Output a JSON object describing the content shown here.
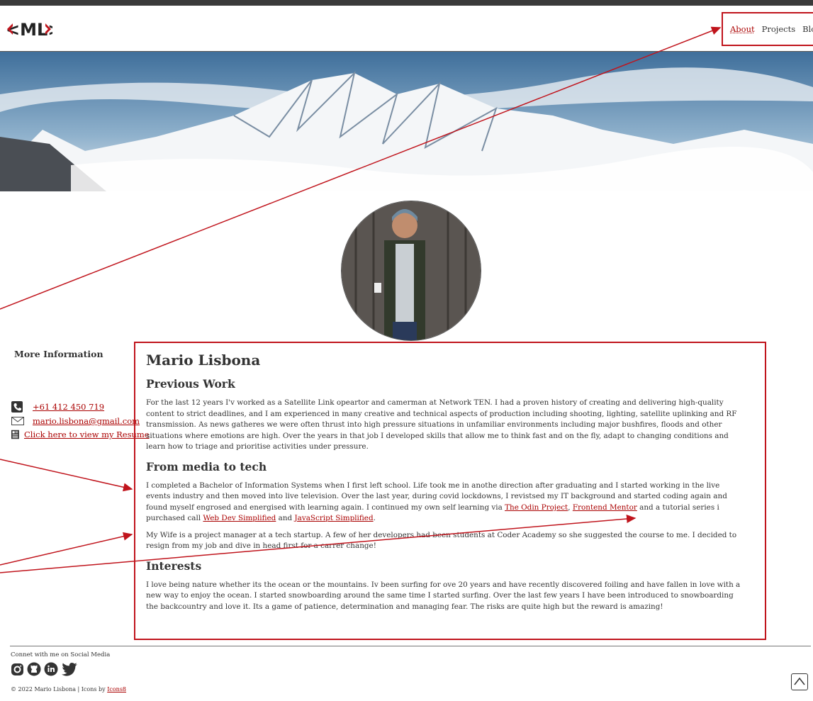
{
  "logo": {
    "text": "<ML>"
  },
  "nav": {
    "items": [
      "About",
      "Projects",
      "Blog"
    ]
  },
  "sidebar": {
    "title": "More Information",
    "phone": "+61 412 450 719",
    "email": "mario.lisbona@gmail.com",
    "resume": "Click here to view my Resume"
  },
  "main": {
    "name": "Mario Lisbona",
    "previous_work_heading": "Previous Work",
    "previous_work_text": "For the last 12 years I'v worked as a Satellite Link opeartor and camerman at Network TEN. I had a proven history of creating and delivering high-quality content to strict deadlines, and I am experienced in many creative and technical aspects of production including shooting, lighting, satellite uplinking and RF transmission. As news gatheres we were often thrust into high pressure situations in unfamiliar environments including major bushfires, floods and other situations where emotions are high. Over the years in that job I developed skills that allow me to think fast and on the fly, adapt to changing conditions and learn how to triage and prioritise activities under pressure.",
    "media_heading": "From media to tech",
    "media_text_1": "I completed a Bachelor of Information Systems when I first left school. Life took me in anothe direction after graduating and I started working in the live events industry and then moved into live television. Over the last year, during covid lockdowns, I revistsed my IT background and started coding again and found myself engrosed and energised with learning again. I continued my own self learning via ",
    "link_odin": "The Odin Project",
    "sep_1": ", ",
    "link_frontend": "Frontend Mentor",
    "media_text_2": " and a tutorial series i purchased call ",
    "link_webdev": "Web Dev Simplified",
    "media_text_3": " and ",
    "link_js": "JavaScript Simplified",
    "media_text_4": ".",
    "wife_text": "My Wife is a project manager at a tech startup. A few of her developers had been students at Coder Academy so she suggested the course to me. I decided to resign from my job and dive in head first for a carrer change!",
    "interests_heading": "Interests",
    "interests_text": "I love being nature whether its the ocean or the mountains. Iv been surfing for ove 20 years and have recently discovered foiling and have fallen in love with a new way to enjoy the ocean. I started snowboarding around the same time I started surfing. Over the last few years I have been introduced to snowboarding the backcountry and love it. Its a game of patience, determination and managing fear. The risks are quite high but the reward is amazing!"
  },
  "footer": {
    "social_title": "Connet with me on Social Media",
    "social_icons": [
      "instagram-icon",
      "github-icon",
      "linkedin-icon",
      "twitter-icon"
    ],
    "copyright": "© 2022 Mario Lisbona | Icons by ",
    "icons_link": "Icons8"
  },
  "colors": {
    "accent": "#a00000",
    "annotation": "#c0141c",
    "text": "#333333"
  }
}
